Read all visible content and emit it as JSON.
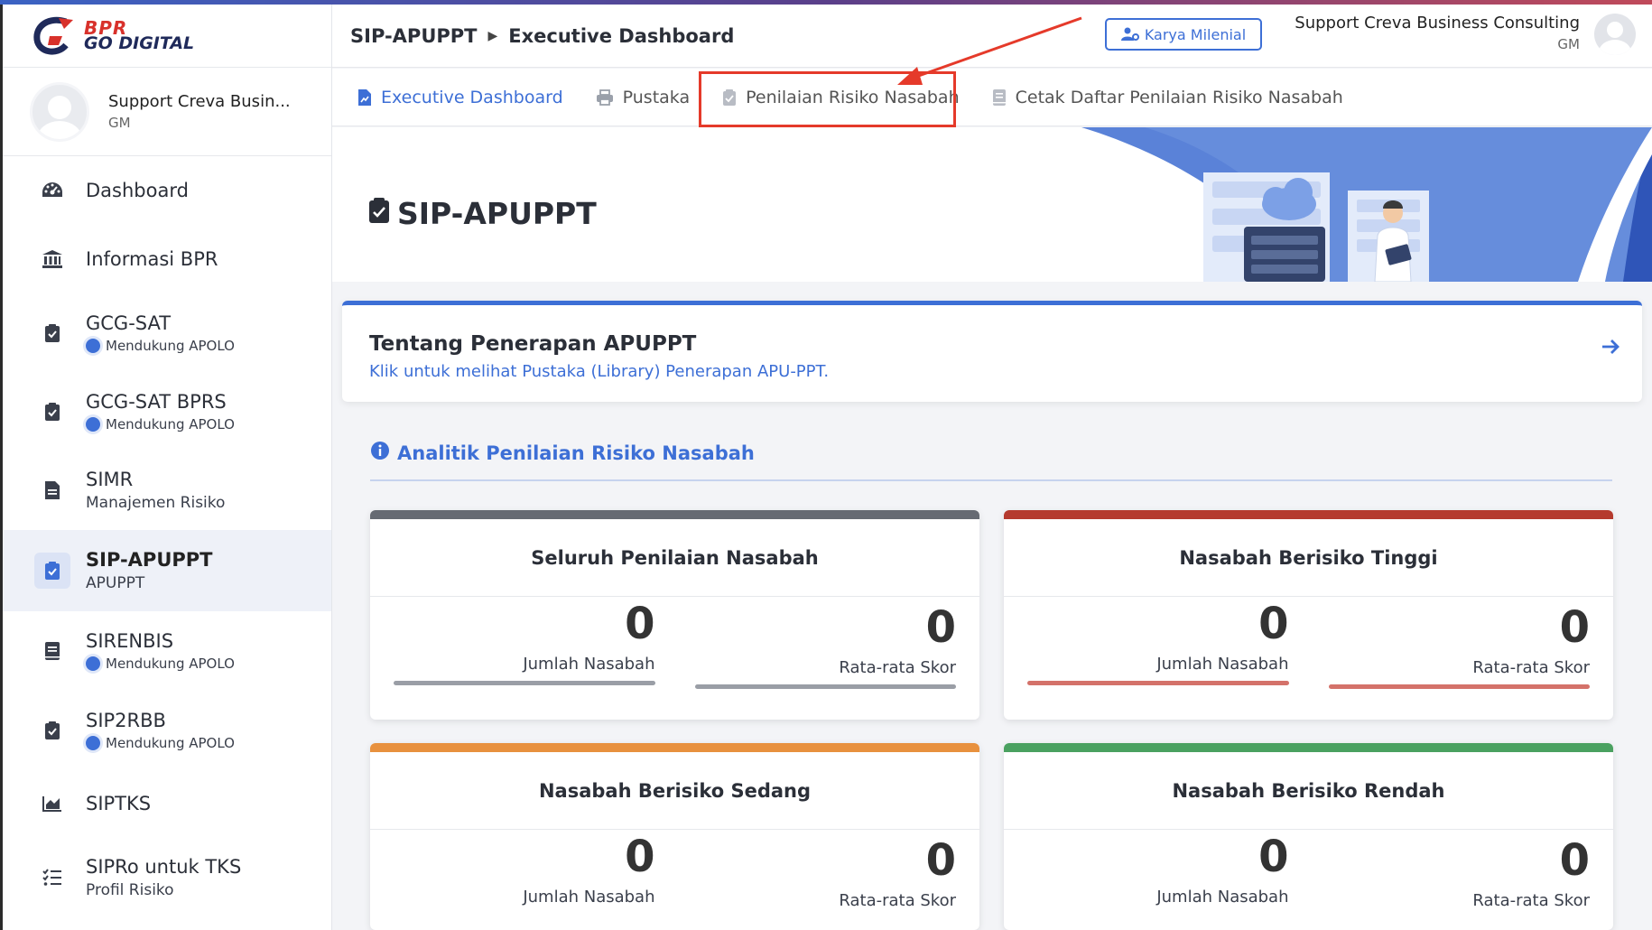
{
  "logo": {
    "line1": "BPR",
    "line2": "GO DIGITAL"
  },
  "sidebar": {
    "profile": {
      "name": "Support Creva Busin...",
      "role": "GM"
    },
    "items": [
      {
        "title": "Dashboard",
        "icon": "gauge-icon"
      },
      {
        "title": "Informasi BPR",
        "icon": "bank-icon"
      },
      {
        "title": "GCG-SAT",
        "badge": "Mendukung APOLO",
        "icon": "clipboard-check-icon"
      },
      {
        "title": "GCG-SAT BPRS",
        "badge": "Mendukung APOLO",
        "icon": "clipboard-check-icon"
      },
      {
        "title": "SIMR",
        "subtitle": "Manajemen Risiko",
        "icon": "document-icon"
      },
      {
        "title": "SIP-APUPPT",
        "subtitle": "APUPPT",
        "icon": "clipboard-check-icon",
        "active": true
      },
      {
        "title": "SIRENBIS",
        "badge": "Mendukung APOLO",
        "icon": "book-icon"
      },
      {
        "title": "SIP2RBB",
        "badge": "Mendukung APOLO",
        "icon": "clipboard-check-icon"
      },
      {
        "title": "SIPTKS",
        "icon": "area-chart-icon"
      },
      {
        "title": "SIPRo untuk TKS",
        "subtitle": "Profil Risiko",
        "icon": "list-check-icon"
      }
    ]
  },
  "header": {
    "breadcrumb": [
      "SIP-APUPPT",
      "Executive Dashboard"
    ],
    "karya_button": "Karya Milenial",
    "user_name": "Support Creva Business Consulting",
    "user_role": "GM"
  },
  "tabs": [
    {
      "label": "Executive Dashboard",
      "icon": "chart-file-icon",
      "active": true
    },
    {
      "label": "Pustaka",
      "icon": "printer-icon"
    },
    {
      "label": "Penilaian Risiko Nasabah",
      "icon": "clipboard-check-icon"
    },
    {
      "label": "Cetak Daftar Penilaian Risiko Nasabah",
      "icon": "book-icon"
    }
  ],
  "banner": {
    "title": "SIP-APUPPT"
  },
  "info_card": {
    "title": "Tentang Penerapan APUPPT",
    "subtitle": "Klik untuk melihat Pustaka (Library) Penerapan APU-PPT."
  },
  "section": {
    "title": "Analitik Penilaian Risiko Nasabah"
  },
  "stat_cards": [
    {
      "title": "Seluruh Penilaian Nasabah",
      "count": "0",
      "count_label": "Jumlah Nasabah",
      "score": "0",
      "score_label": "Rata-rata Skor",
      "color": "#666a73",
      "bar_color": "#9a9ea6"
    },
    {
      "title": "Nasabah Berisiko Tinggi",
      "count": "0",
      "count_label": "Jumlah Nasabah",
      "score": "0",
      "score_label": "Rata-rata Skor",
      "color": "#b53a2e",
      "bar_color": "#d4726a"
    },
    {
      "title": "Nasabah Berisiko Sedang",
      "count": "0",
      "count_label": "Jumlah Nasabah",
      "score": "0",
      "score_label": "Rata-rata Skor",
      "color": "#e8913e",
      "bar_color": "#f0b27a"
    },
    {
      "title": "Nasabah Berisiko Rendah",
      "count": "0",
      "count_label": "Jumlah Nasabah",
      "score": "0",
      "score_label": "Rata-rata Skor",
      "color": "#4aa160",
      "bar_color": "#7cc28e"
    }
  ],
  "colors": {
    "accent": "#3d6fd6",
    "highlight": "#e53a2a"
  }
}
